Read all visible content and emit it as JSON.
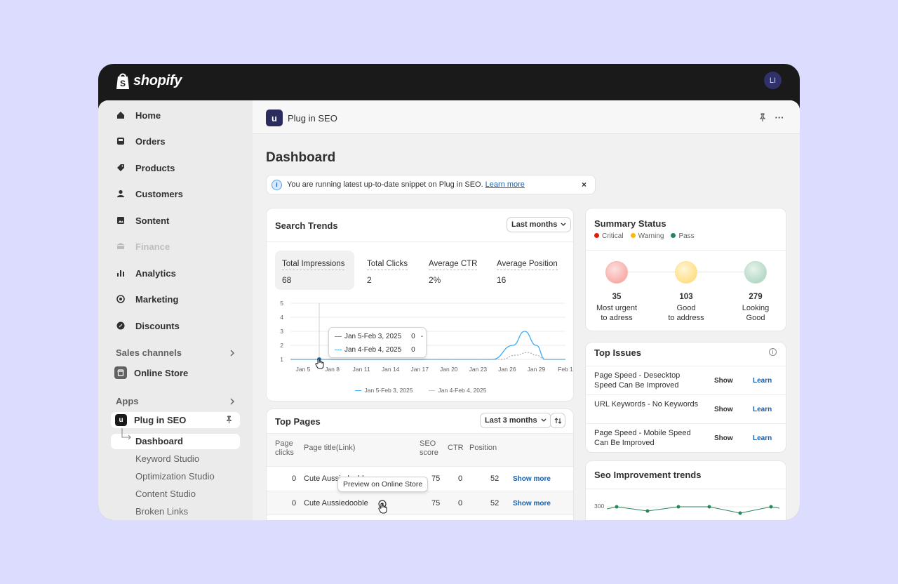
{
  "topbar": {
    "brand": "shopify",
    "avatar": "LI"
  },
  "sidebar": {
    "items": [
      {
        "label": "Home",
        "icon": "home-icon"
      },
      {
        "label": "Orders",
        "icon": "inbox-icon"
      },
      {
        "label": "Products",
        "icon": "tag-icon"
      },
      {
        "label": "Customers",
        "icon": "person-icon"
      },
      {
        "label": "Sontent",
        "icon": "image-icon"
      },
      {
        "label": "Finance",
        "icon": "bank-icon"
      },
      {
        "label": "Analytics",
        "icon": "bar-chart-icon"
      },
      {
        "label": "Marketing",
        "icon": "target-icon"
      },
      {
        "label": "Discounts",
        "icon": "discount-icon"
      }
    ],
    "sales_channels": "Sales channels",
    "online_store": "Online Store",
    "apps": "Apps",
    "app_name": "Plug in SEO",
    "app_icon_letter": "u",
    "subitems": [
      "Dashboard",
      "Keyword Studio",
      "Optimization Studio",
      "Content Studio",
      "Broken Links"
    ]
  },
  "header": {
    "app_title": "Plug in SEO",
    "app_icon_letter": "u",
    "more": "···"
  },
  "page": {
    "title": "Dashboard"
  },
  "banner": {
    "text": "You are running latest up-to-date snippet on Plug in SEO.",
    "link": "Learn more",
    "info": "i",
    "close": "×"
  },
  "search_trends": {
    "title": "Search Trends",
    "range": "Last months",
    "metrics": [
      {
        "label": "Total Impressions",
        "value": "68"
      },
      {
        "label": "Total Clicks",
        "value": "2"
      },
      {
        "label": "Average CTR",
        "value": "2%"
      },
      {
        "label": "Average Position",
        "value": "16"
      }
    ],
    "tooltip": [
      {
        "label": "Jan 5-Feb 3, 2025",
        "value": "0",
        "extra": "-"
      },
      {
        "label": "Jan 4-Feb 4, 2025",
        "value": "0"
      }
    ],
    "legend": [
      "Jan 5-Feb 3, 2025",
      "Jan 4-Feb 4, 2025"
    ]
  },
  "chart_data": {
    "type": "line",
    "categories": [
      "Jan 5",
      "Jan 8",
      "Jan 11",
      "Jan 14",
      "Jan 17",
      "Jan 20",
      "Jan 23",
      "Jan 26",
      "Jan 29",
      "Feb 1"
    ],
    "yticks": [
      "5",
      "4",
      "3",
      "2",
      "1"
    ],
    "ylim": [
      0,
      5
    ],
    "series": [
      {
        "name": "Jan 5-Feb 3, 2025",
        "x": [
          0,
          6.5,
          7.2,
          7.6,
          8.0,
          8.3,
          9
        ],
        "values": [
          1,
          1,
          2,
          3,
          2,
          1,
          1
        ]
      },
      {
        "name": "Jan 4-Feb 4, 2025",
        "x": [
          0,
          6.8,
          7.3,
          7.7,
          8.0,
          8.3,
          9
        ],
        "values": [
          1,
          1,
          1.3,
          1.5,
          1.3,
          1,
          1
        ]
      }
    ],
    "colors": [
      "#3fa9f5",
      "#a8a8a8"
    ]
  },
  "summary": {
    "title": "Summary Status",
    "legend": [
      {
        "label": "Critical",
        "color": "#e51c00"
      },
      {
        "label": "Warning",
        "color": "#ffb800"
      },
      {
        "label": "Pass",
        "color": "#29845a"
      }
    ],
    "stats": [
      {
        "n": "35",
        "l1": "Most urgent",
        "l2": "to adress"
      },
      {
        "n": "103",
        "l1": "Good",
        "l2": "to address"
      },
      {
        "n": "279",
        "l1": "Looking",
        "l2": "Good"
      }
    ]
  },
  "top_issues": {
    "title": "Top Issues",
    "info": "i",
    "rows": [
      {
        "title": "Page Speed - Desecktop Speed Can Be Improved",
        "show": "Show",
        "learn": "Learn"
      },
      {
        "title": "URL Keywords - No Keywords",
        "show": "Show",
        "learn": "Learn"
      },
      {
        "title": "Page Speed - Mobile Speed Can Be Improved",
        "show": "Show",
        "learn": "Learn"
      }
    ]
  },
  "top_pages": {
    "title": "Top Pages",
    "range": "Last 3 months",
    "headers": {
      "clicks": "Page clicks",
      "title": "Page title(Link)",
      "seo": "SEO score",
      "ctr": "CTR",
      "position": "Position"
    },
    "rows": [
      {
        "clicks": "0",
        "title": "Cute Aussiedooble",
        "seo": "75",
        "ctr": "0",
        "position": "52",
        "more": "Show more"
      },
      {
        "clicks": "0",
        "title": "Cute Aussiedooble",
        "seo": "75",
        "ctr": "0",
        "position": "52",
        "more": "Show more"
      }
    ],
    "preview_tip": "Preview on Online Store"
  },
  "seo_trends": {
    "title": "Seo Improvement trends",
    "ytick": "300",
    "points": [
      300,
      298,
      300,
      300,
      297,
      300
    ]
  }
}
